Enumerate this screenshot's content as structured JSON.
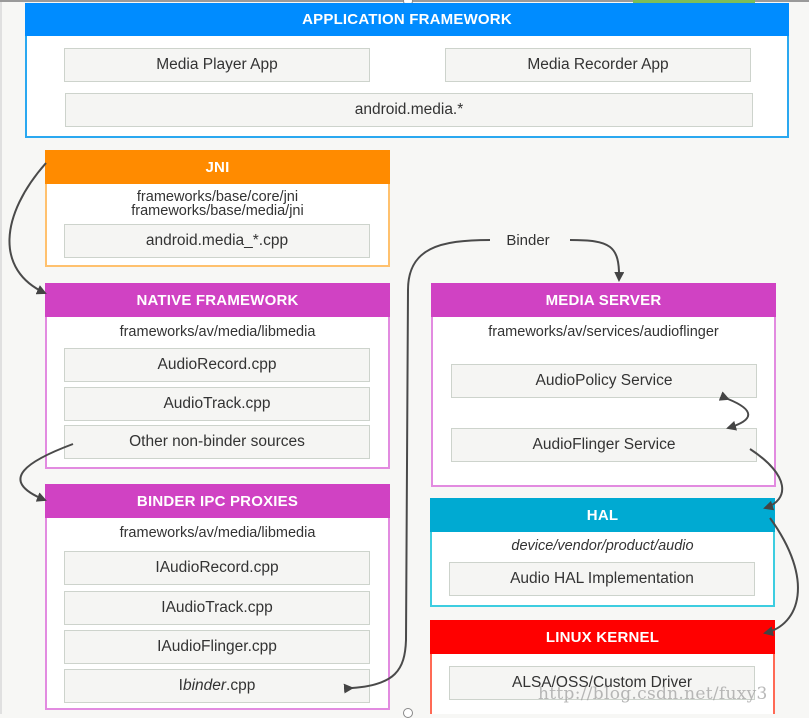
{
  "app_framework": {
    "title": "APPLICATION FRAMEWORK",
    "items": [
      "Media Player App",
      "Media Recorder App",
      "android.media.*"
    ],
    "color": "#008cff"
  },
  "jni": {
    "title": "JNI",
    "paths": [
      "frameworks/base/core/jni",
      "frameworks/base/media/jni"
    ],
    "items": [
      "android.media_*.cpp"
    ],
    "color": "#ff8b00"
  },
  "native_framework": {
    "title": "NATIVE FRAMEWORK",
    "path": "frameworks/av/media/libmedia",
    "items": [
      "AudioRecord.cpp",
      "AudioTrack.cpp",
      "Other non-binder sources"
    ],
    "color": "#d042c3"
  },
  "binder_ipc": {
    "title": "BINDER IPC PROXIES",
    "path": "frameworks/av/media/libmedia",
    "items": [
      "IAudioRecord.cpp",
      "IAudioTrack.cpp",
      "IAudioFlinger.cpp"
    ],
    "ibinder_prefix": "I",
    "ibinder_italic": "binder",
    "ibinder_suffix": ".cpp",
    "color": "#d042c3"
  },
  "media_server": {
    "title": "MEDIA SERVER",
    "path": "frameworks/av/services/audioflinger",
    "items": [
      "AudioPolicy Service",
      "AudioFlinger Service"
    ],
    "color": "#d042c3"
  },
  "hal": {
    "title": "HAL",
    "path": "device/vendor/product/audio",
    "items": [
      "Audio HAL Implementation"
    ],
    "color": "#00aad2"
  },
  "linux_kernel": {
    "title": "LINUX KERNEL",
    "items": [
      "ALSA/OSS/Custom Driver"
    ],
    "color": "#ff0000"
  },
  "connectors": {
    "binder_label": "Binder",
    "edges": [
      {
        "from": "jni",
        "to": "native_framework"
      },
      {
        "from": "native_framework.other_non_binder_sources",
        "to": "binder_ipc"
      },
      {
        "from": "binder_ipc.ibinder",
        "to": "media_server",
        "label": "Binder"
      },
      {
        "from": "media_server.audiopolicy_service",
        "to": "media_server.audioflinger_service",
        "bidirectional": true
      },
      {
        "from": "media_server.audioflinger_service",
        "to": "hal"
      },
      {
        "from": "hal",
        "to": "linux_kernel"
      }
    ]
  },
  "watermark": "http://blog.csdn.net/fuxy3"
}
